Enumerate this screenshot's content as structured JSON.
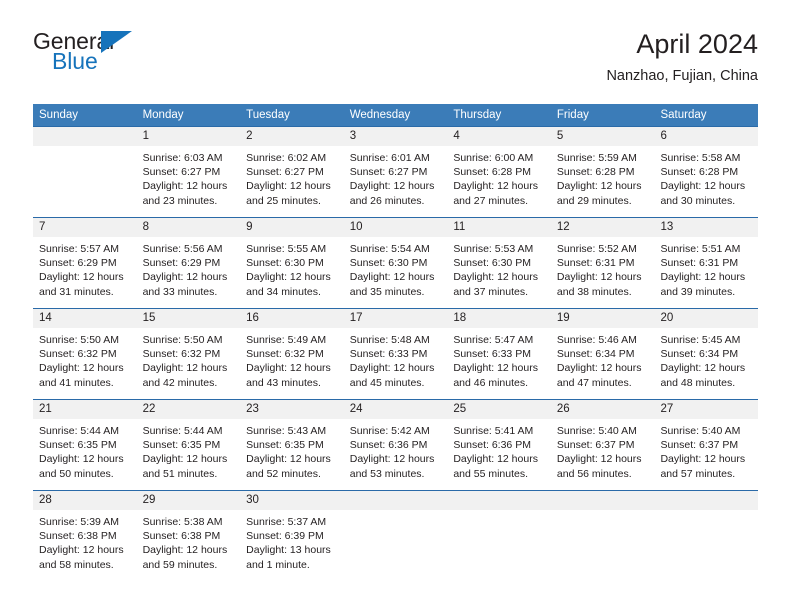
{
  "brand": {
    "name_part1": "General",
    "name_part2": "Blue",
    "triangle_color": "#1673bb",
    "text_color": "#231f20"
  },
  "header": {
    "title": "April 2024",
    "subtitle": "Nanzhao, Fujian, China"
  },
  "theme": {
    "header_bar_color": "#3b7cb8",
    "week_divider_color": "#2a6aa8",
    "daynum_band_color": "#f1f1f1",
    "text_color": "#231f20",
    "header_text_color": "#ffffff"
  },
  "weekdays": [
    "Sunday",
    "Monday",
    "Tuesday",
    "Wednesday",
    "Thursday",
    "Friday",
    "Saturday"
  ],
  "weeks": [
    {
      "daynums": [
        "",
        "1",
        "2",
        "3",
        "4",
        "5",
        "6"
      ],
      "cells": [
        {
          "day": "",
          "sunrise": "",
          "sunset": "",
          "daylight1": "",
          "daylight2": ""
        },
        {
          "day": "1",
          "sunrise": "Sunrise: 6:03 AM",
          "sunset": "Sunset: 6:27 PM",
          "daylight1": "Daylight: 12 hours",
          "daylight2": "and 23 minutes."
        },
        {
          "day": "2",
          "sunrise": "Sunrise: 6:02 AM",
          "sunset": "Sunset: 6:27 PM",
          "daylight1": "Daylight: 12 hours",
          "daylight2": "and 25 minutes."
        },
        {
          "day": "3",
          "sunrise": "Sunrise: 6:01 AM",
          "sunset": "Sunset: 6:27 PM",
          "daylight1": "Daylight: 12 hours",
          "daylight2": "and 26 minutes."
        },
        {
          "day": "4",
          "sunrise": "Sunrise: 6:00 AM",
          "sunset": "Sunset: 6:28 PM",
          "daylight1": "Daylight: 12 hours",
          "daylight2": "and 27 minutes."
        },
        {
          "day": "5",
          "sunrise": "Sunrise: 5:59 AM",
          "sunset": "Sunset: 6:28 PM",
          "daylight1": "Daylight: 12 hours",
          "daylight2": "and 29 minutes."
        },
        {
          "day": "6",
          "sunrise": "Sunrise: 5:58 AM",
          "sunset": "Sunset: 6:28 PM",
          "daylight1": "Daylight: 12 hours",
          "daylight2": "and 30 minutes."
        }
      ]
    },
    {
      "daynums": [
        "7",
        "8",
        "9",
        "10",
        "11",
        "12",
        "13"
      ],
      "cells": [
        {
          "day": "7",
          "sunrise": "Sunrise: 5:57 AM",
          "sunset": "Sunset: 6:29 PM",
          "daylight1": "Daylight: 12 hours",
          "daylight2": "and 31 minutes."
        },
        {
          "day": "8",
          "sunrise": "Sunrise: 5:56 AM",
          "sunset": "Sunset: 6:29 PM",
          "daylight1": "Daylight: 12 hours",
          "daylight2": "and 33 minutes."
        },
        {
          "day": "9",
          "sunrise": "Sunrise: 5:55 AM",
          "sunset": "Sunset: 6:30 PM",
          "daylight1": "Daylight: 12 hours",
          "daylight2": "and 34 minutes."
        },
        {
          "day": "10",
          "sunrise": "Sunrise: 5:54 AM",
          "sunset": "Sunset: 6:30 PM",
          "daylight1": "Daylight: 12 hours",
          "daylight2": "and 35 minutes."
        },
        {
          "day": "11",
          "sunrise": "Sunrise: 5:53 AM",
          "sunset": "Sunset: 6:30 PM",
          "daylight1": "Daylight: 12 hours",
          "daylight2": "and 37 minutes."
        },
        {
          "day": "12",
          "sunrise": "Sunrise: 5:52 AM",
          "sunset": "Sunset: 6:31 PM",
          "daylight1": "Daylight: 12 hours",
          "daylight2": "and 38 minutes."
        },
        {
          "day": "13",
          "sunrise": "Sunrise: 5:51 AM",
          "sunset": "Sunset: 6:31 PM",
          "daylight1": "Daylight: 12 hours",
          "daylight2": "and 39 minutes."
        }
      ]
    },
    {
      "daynums": [
        "14",
        "15",
        "16",
        "17",
        "18",
        "19",
        "20"
      ],
      "cells": [
        {
          "day": "14",
          "sunrise": "Sunrise: 5:50 AM",
          "sunset": "Sunset: 6:32 PM",
          "daylight1": "Daylight: 12 hours",
          "daylight2": "and 41 minutes."
        },
        {
          "day": "15",
          "sunrise": "Sunrise: 5:50 AM",
          "sunset": "Sunset: 6:32 PM",
          "daylight1": "Daylight: 12 hours",
          "daylight2": "and 42 minutes."
        },
        {
          "day": "16",
          "sunrise": "Sunrise: 5:49 AM",
          "sunset": "Sunset: 6:32 PM",
          "daylight1": "Daylight: 12 hours",
          "daylight2": "and 43 minutes."
        },
        {
          "day": "17",
          "sunrise": "Sunrise: 5:48 AM",
          "sunset": "Sunset: 6:33 PM",
          "daylight1": "Daylight: 12 hours",
          "daylight2": "and 45 minutes."
        },
        {
          "day": "18",
          "sunrise": "Sunrise: 5:47 AM",
          "sunset": "Sunset: 6:33 PM",
          "daylight1": "Daylight: 12 hours",
          "daylight2": "and 46 minutes."
        },
        {
          "day": "19",
          "sunrise": "Sunrise: 5:46 AM",
          "sunset": "Sunset: 6:34 PM",
          "daylight1": "Daylight: 12 hours",
          "daylight2": "and 47 minutes."
        },
        {
          "day": "20",
          "sunrise": "Sunrise: 5:45 AM",
          "sunset": "Sunset: 6:34 PM",
          "daylight1": "Daylight: 12 hours",
          "daylight2": "and 48 minutes."
        }
      ]
    },
    {
      "daynums": [
        "21",
        "22",
        "23",
        "24",
        "25",
        "26",
        "27"
      ],
      "cells": [
        {
          "day": "21",
          "sunrise": "Sunrise: 5:44 AM",
          "sunset": "Sunset: 6:35 PM",
          "daylight1": "Daylight: 12 hours",
          "daylight2": "and 50 minutes."
        },
        {
          "day": "22",
          "sunrise": "Sunrise: 5:44 AM",
          "sunset": "Sunset: 6:35 PM",
          "daylight1": "Daylight: 12 hours",
          "daylight2": "and 51 minutes."
        },
        {
          "day": "23",
          "sunrise": "Sunrise: 5:43 AM",
          "sunset": "Sunset: 6:35 PM",
          "daylight1": "Daylight: 12 hours",
          "daylight2": "and 52 minutes."
        },
        {
          "day": "24",
          "sunrise": "Sunrise: 5:42 AM",
          "sunset": "Sunset: 6:36 PM",
          "daylight1": "Daylight: 12 hours",
          "daylight2": "and 53 minutes."
        },
        {
          "day": "25",
          "sunrise": "Sunrise: 5:41 AM",
          "sunset": "Sunset: 6:36 PM",
          "daylight1": "Daylight: 12 hours",
          "daylight2": "and 55 minutes."
        },
        {
          "day": "26",
          "sunrise": "Sunrise: 5:40 AM",
          "sunset": "Sunset: 6:37 PM",
          "daylight1": "Daylight: 12 hours",
          "daylight2": "and 56 minutes."
        },
        {
          "day": "27",
          "sunrise": "Sunrise: 5:40 AM",
          "sunset": "Sunset: 6:37 PM",
          "daylight1": "Daylight: 12 hours",
          "daylight2": "and 57 minutes."
        }
      ]
    },
    {
      "daynums": [
        "28",
        "29",
        "30",
        "",
        "",
        "",
        ""
      ],
      "cells": [
        {
          "day": "28",
          "sunrise": "Sunrise: 5:39 AM",
          "sunset": "Sunset: 6:38 PM",
          "daylight1": "Daylight: 12 hours",
          "daylight2": "and 58 minutes."
        },
        {
          "day": "29",
          "sunrise": "Sunrise: 5:38 AM",
          "sunset": "Sunset: 6:38 PM",
          "daylight1": "Daylight: 12 hours",
          "daylight2": "and 59 minutes."
        },
        {
          "day": "30",
          "sunrise": "Sunrise: 5:37 AM",
          "sunset": "Sunset: 6:39 PM",
          "daylight1": "Daylight: 13 hours",
          "daylight2": "and 1 minute."
        },
        {
          "day": "",
          "sunrise": "",
          "sunset": "",
          "daylight1": "",
          "daylight2": ""
        },
        {
          "day": "",
          "sunrise": "",
          "sunset": "",
          "daylight1": "",
          "daylight2": ""
        },
        {
          "day": "",
          "sunrise": "",
          "sunset": "",
          "daylight1": "",
          "daylight2": ""
        },
        {
          "day": "",
          "sunrise": "",
          "sunset": "",
          "daylight1": "",
          "daylight2": ""
        }
      ]
    }
  ]
}
